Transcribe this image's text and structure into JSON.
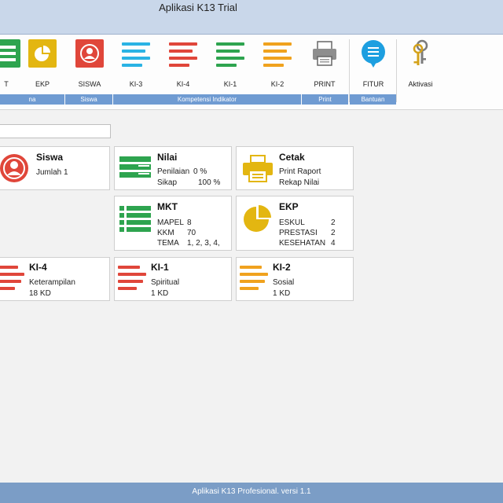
{
  "window": {
    "title": "Aplikasi K13 Trial"
  },
  "ribbon": {
    "buttons": [
      {
        "label": "T",
        "icon": "table-icon"
      },
      {
        "label": "EKP",
        "icon": "pie-chart-icon"
      },
      {
        "label": "SISWA",
        "icon": "user-icon"
      },
      {
        "label": "KI-3",
        "icon": "lines-icon"
      },
      {
        "label": "KI-4",
        "icon": "lines-icon"
      },
      {
        "label": "KI-1",
        "icon": "lines-icon"
      },
      {
        "label": "KI-2",
        "icon": "lines-icon"
      },
      {
        "label": "PRINT",
        "icon": "printer-icon"
      },
      {
        "label": "FITUR",
        "icon": "chat-bubble-icon"
      },
      {
        "label": "Aktivasi",
        "icon": "keys-icon"
      }
    ],
    "groups": [
      "na",
      "Siswa",
      "Kompetensi Indikator",
      "Print",
      "Bantuan"
    ]
  },
  "tiles": {
    "siswa": {
      "title": "Siswa",
      "line1": "Jumlah 1"
    },
    "nilai": {
      "title": "Nilai",
      "line1_label": "Penilaian",
      "line1_value": "0 %",
      "line2_label": "Sikap",
      "line2_value": "100 %"
    },
    "cetak": {
      "title": "Cetak",
      "line1": "Print Raport",
      "line2": "Rekap Nilai"
    },
    "mkt": {
      "title": "MKT",
      "mapel_label": "MAPEL",
      "mapel_value": "8",
      "kkm_label": "KKM",
      "kkm_value": "70",
      "tema_label": "TEMA",
      "tema_value": "1, 2, 3, 4,"
    },
    "ekp": {
      "title": "EKP",
      "eskul_label": "ESKUL",
      "eskul_value": "2",
      "prestasi_label": "PRESTASI",
      "prestasi_value": "2",
      "kesehatan_label": "KESEHATAN",
      "kesehatan_value": "4"
    },
    "ki4": {
      "title": "KI-4",
      "line1": "Keterampilan",
      "line2": "18 KD"
    },
    "ki1": {
      "title": "KI-1",
      "line1": "Spiritual",
      "line2": "1 KD"
    },
    "ki2": {
      "title": "KI-2",
      "line1": "Sosial",
      "line2": "1 KD"
    }
  },
  "status": {
    "text": "Aplikasi K13 Profesional. versi 1.1"
  },
  "colors": {
    "green": "#2ea44f",
    "yellow": "#e3b611",
    "red": "#e0463a",
    "cyan": "#2ab3e4",
    "orange": "#f0a21e",
    "group_blue": "#6f9bd2"
  }
}
